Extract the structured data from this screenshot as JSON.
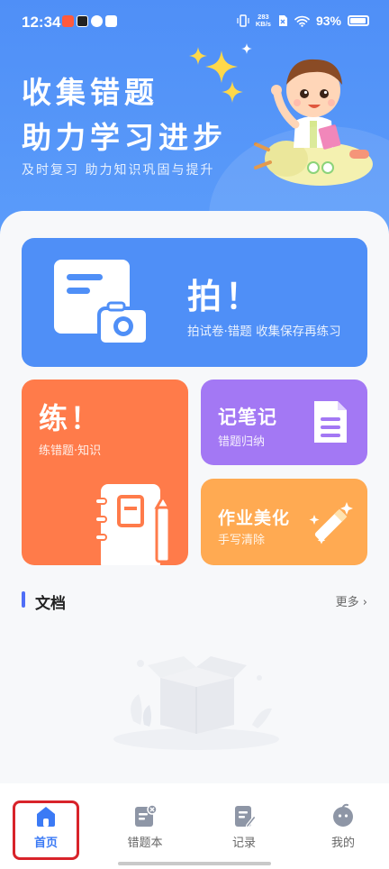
{
  "status_bar": {
    "time": "12:34",
    "net_speed_top": "283",
    "net_speed_bottom": "KB/s",
    "battery": "93%"
  },
  "hero": {
    "title_line1": "收集错题",
    "title_line2": "助力学习进步",
    "subtitle": "及时复习 助力知识巩固与提升"
  },
  "cards": {
    "photo": {
      "title": "拍！",
      "desc": "拍试卷·错题 收集保存再练习",
      "icon": "document-camera-icon"
    },
    "practice": {
      "title": "练！",
      "desc": "练错题·知识",
      "icon": "notebook-pen-icon"
    },
    "notes": {
      "title": "记笔记",
      "desc": "错题归纳",
      "icon": "notes-icon"
    },
    "beautify": {
      "title": "作业美化",
      "desc": "手写清除",
      "icon": "magic-wand-icon"
    }
  },
  "documents": {
    "title": "文档",
    "more": "更多 ›",
    "empty_icon": "empty-box-icon"
  },
  "bottom_nav": [
    {
      "label": "首页",
      "icon": "home-icon",
      "active": true
    },
    {
      "label": "错题本",
      "icon": "mistake-book-icon",
      "active": false
    },
    {
      "label": "记录",
      "icon": "record-icon",
      "active": false
    },
    {
      "label": "我的",
      "icon": "profile-icon",
      "active": false
    }
  ],
  "colors": {
    "primary": "#4f8ff7",
    "practice": "#ff7b4a",
    "notes": "#a378f4",
    "beautify": "#ffaa52",
    "highlight": "#d8232a"
  }
}
